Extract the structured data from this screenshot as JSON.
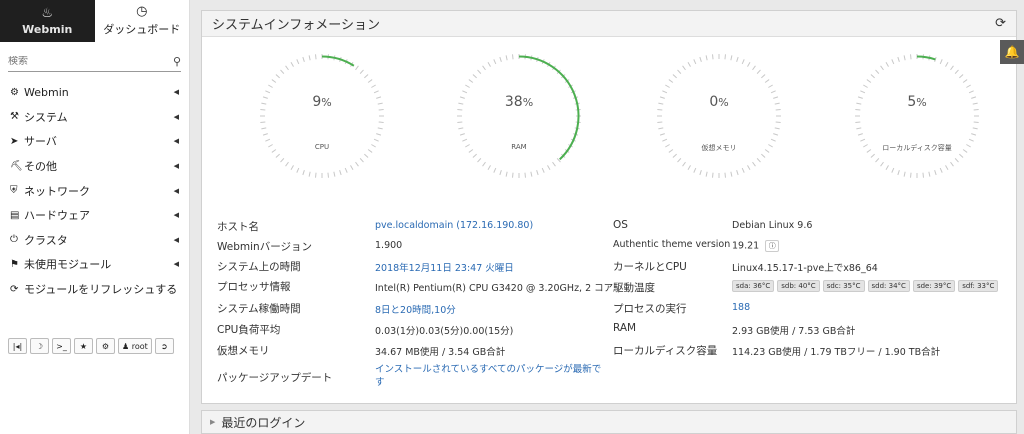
{
  "sidebar": {
    "tabs": [
      {
        "label": "Webmin",
        "icon": "webmin-logo-icon"
      },
      {
        "label": "ダッシュボード",
        "icon": "dashboard-icon"
      }
    ],
    "search": {
      "placeholder": "検索"
    },
    "menu": [
      {
        "label": "Webmin",
        "icon": "gear-icon"
      },
      {
        "label": "システム",
        "icon": "wrench-icon"
      },
      {
        "label": "サーバ",
        "icon": "rocket-icon"
      },
      {
        "label": "その他",
        "icon": "tools-icon"
      },
      {
        "label": "ネットワーク",
        "icon": "shield-icon"
      },
      {
        "label": "ハードウェア",
        "icon": "hdd-icon"
      },
      {
        "label": "クラスタ",
        "icon": "power-icon"
      },
      {
        "label": "未使用モジュール",
        "icon": "puzzle-icon"
      },
      {
        "label": "モジュールをリフレッシュする",
        "icon": "refresh-icon"
      }
    ],
    "tools": {
      "user": "root"
    }
  },
  "panel": {
    "title": "システムインフォメーション",
    "gauges": [
      {
        "label": "CPU",
        "value": 9,
        "display": "9"
      },
      {
        "label": "RAM",
        "value": 38,
        "display": "38"
      },
      {
        "label": "仮想メモリ",
        "value": 0,
        "display": "0"
      },
      {
        "label": "ローカルディスク容量",
        "value": 5,
        "display": "5"
      }
    ],
    "gauge_unit": "%",
    "left_info": [
      {
        "label": "ホスト名",
        "value": "pve.localdomain (172.16.190.80)",
        "link": true
      },
      {
        "label": "Webminバージョン",
        "value": "1.900",
        "link": false
      },
      {
        "label": "システム上の時間",
        "value": "2018年12月11日 23:47 火曜日",
        "link": true
      },
      {
        "label": "プロセッサ情報",
        "value": "Intel(R) Pentium(R) CPU G3420 @ 3.20GHz, 2 コア",
        "link": false
      },
      {
        "label": "システム稼働時間",
        "value": "8日と20時間,10分",
        "link": true
      },
      {
        "label": "CPU負荷平均",
        "value": "0.03(1分)0.03(5分)0.00(15分)",
        "link": false
      },
      {
        "label": "仮想メモリ",
        "value": "34.67 MB使用 / 3.54 GB合計",
        "link": false
      },
      {
        "label": "パッケージアップデート",
        "value": "インストールされているすべてのパッケージが最新です",
        "link": true
      }
    ],
    "right_info": [
      {
        "label": "OS",
        "value": "Debian Linux 9.6"
      },
      {
        "label": "Authentic theme version",
        "value": "19.21"
      },
      {
        "label": "カーネルとCPU",
        "value": "Linux4.15.17-1-pve上でx86_64"
      },
      {
        "label": "駆動温度",
        "value": ""
      },
      {
        "label": "プロセスの実行",
        "value": "188"
      },
      {
        "label": "RAM",
        "value": "2.93 GB使用 / 7.53 GB合計"
      },
      {
        "label": "ローカルディスク容量",
        "value": "114.23 GB使用 / 1.79 TBフリー / 1.90 TB合計"
      }
    ],
    "temps": [
      "sda: 36°C",
      "sdb: 40°C",
      "sdc: 35°C",
      "sdd: 34°C",
      "sde: 39°C",
      "sdf: 33°C"
    ]
  },
  "login_panel": {
    "title": "最近のログイン"
  },
  "colors": {
    "accent": "#4caf50",
    "link": "#2a6ab3",
    "sidebar_dark": "#1f1f1f"
  }
}
